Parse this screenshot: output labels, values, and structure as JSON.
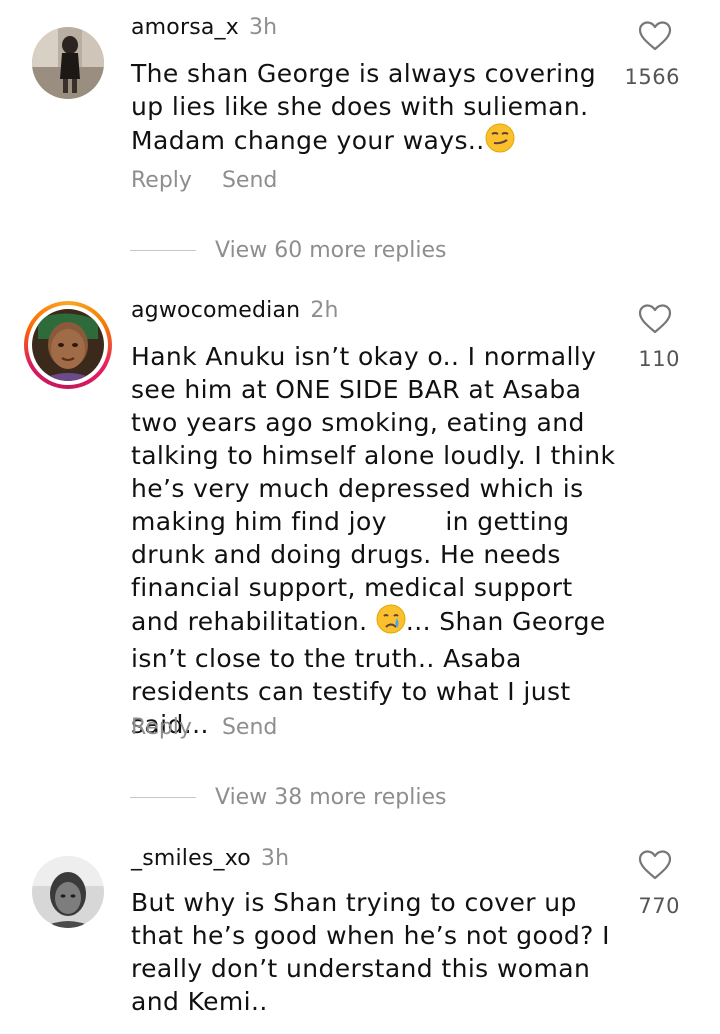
{
  "comments": [
    {
      "username": "amorsa_x",
      "time": "3h",
      "text": "The shan George is always covering up lies like she does with sulieman. Madam change your ways..",
      "text_emoji": "smirking-face-emoji",
      "likes": "1566",
      "reply_label": "Reply",
      "send_label": "Send",
      "view_replies": "View 60 more replies"
    },
    {
      "username": "agwocomedian",
      "time": "2h",
      "text_part1": "Hank Anuku isn’t okay o.. I normally see him at ONE SIDE BAR at Asaba two years ago smoking, eating and talking to himself alone loudly. I think he’s very much depressed which is making him find joy       in getting drunk and doing drugs. He needs financial support, medical support and rehabilitation. ",
      "text_emoji": "crying-face-emoji",
      "text_part2": "... Shan George isn’t close to the truth.. Asaba residents can testify to what I just said...",
      "likes": "110",
      "reply_label": "Reply",
      "send_label": "Send",
      "view_replies": "View 38 more replies",
      "has_story_ring": true
    },
    {
      "username": "_smiles_xo",
      "time": "3h",
      "text": "But why is Shan trying to cover up that he’s good when he’s not good? I really don’t understand this woman and Kemi..",
      "likes": "770"
    }
  ],
  "icons": {
    "like": "heart-outline-icon"
  },
  "colors": {
    "text": "#111111",
    "muted": "#8e8e8e",
    "divider": "#c7c7c7",
    "ring_start": "#f9a825",
    "ring_end": "#d81b60"
  }
}
